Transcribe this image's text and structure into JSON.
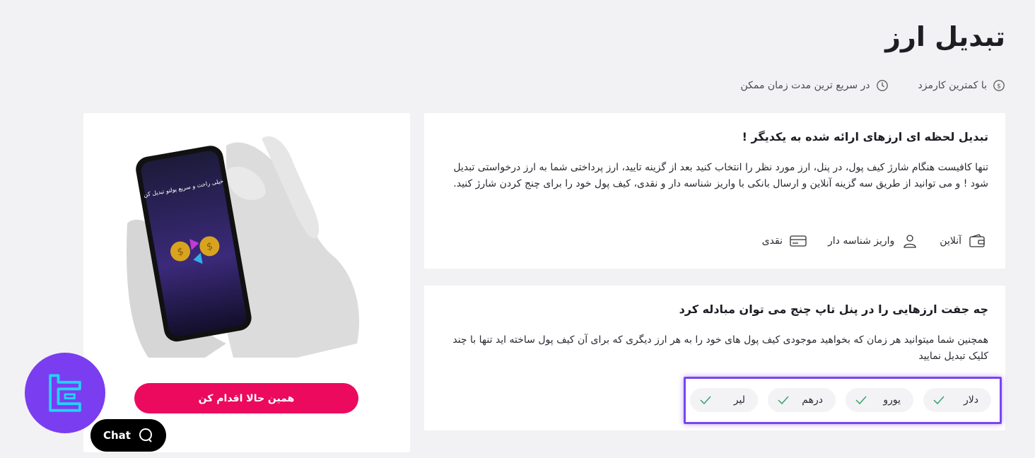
{
  "page": {
    "title": "تبدیل ارز",
    "features": [
      {
        "label": "با کمترین کارمزد",
        "icon": "dollar-circle-icon"
      },
      {
        "label": "در سریع ترین مدت زمان ممکن",
        "icon": "clock-icon"
      }
    ]
  },
  "card1": {
    "title": "تبدیل لحظه ای ارزهای ارائه شده به یکدیگر !",
    "body": "تنها کافیست هنگام شارژ کیف پول، در پنل، ارز مورد نظر را انتخاب کنید بعد از گزینه تایید، ارز پرداختی شما به ارز درخواستی تبدیل شود ! و می توانید از طریق سه گزینه آنلاین و ارسال بانکی با واریز شناسه دار و نقدی، کیف پول خود را برای چنج کردن شارژ کنید.",
    "methods": [
      {
        "label": "آنلاین",
        "icon": "wallet-icon"
      },
      {
        "label": "واریز شناسه دار",
        "icon": "id-user-icon"
      },
      {
        "label": "نقدی",
        "icon": "card-icon"
      }
    ]
  },
  "card2": {
    "title": "چه جفت ارزهایی را در پنل تاپ چنج می توان مبادله کرد",
    "body": "همچنین شما میتوانید هر زمان که بخواهید موجودی کیف پول های خود را به هر ارز دیگری که برای آن کیف پول ساخته اید تنها با چند کلیک تبدیل نمایید",
    "currencies": [
      "دلار",
      "یورو",
      "درهم",
      "لیر"
    ]
  },
  "promo": {
    "phone_text": "خیلی راحت و سریع پولتو تبدیل کن",
    "cta_label": "همین حالا اقدام کن"
  },
  "widgets": {
    "chat_label": "Chat"
  },
  "colors": {
    "accent": "#eb0a5e",
    "highlight": "#7a45ef",
    "brand_logo_bg": "#7b3df0",
    "check": "#3aa06b"
  }
}
